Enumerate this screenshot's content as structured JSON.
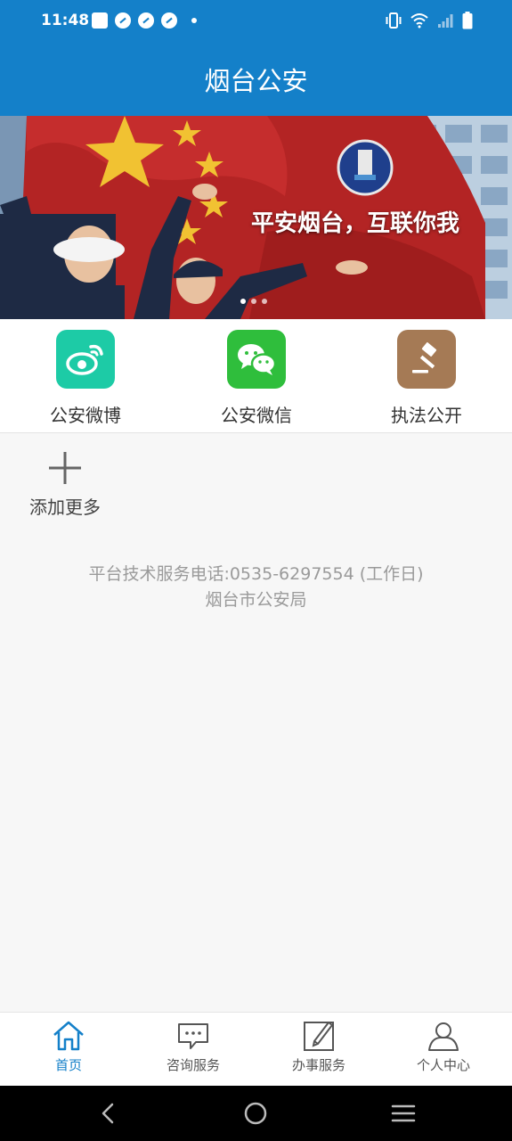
{
  "status_bar": {
    "time": "11:48",
    "left_icons": [
      "mail-icon",
      "app-icon",
      "app-icon",
      "app-icon",
      "dot-icon"
    ],
    "right_icons": [
      "vibrate-icon",
      "wifi-icon",
      "signal-icon",
      "battery-icon"
    ]
  },
  "header": {
    "title": "烟台公安"
  },
  "banner": {
    "slogan": "平安烟台，互联你我",
    "slides": 3,
    "active_slide": 1
  },
  "quick_actions": [
    {
      "label": "公安微博",
      "icon": "weibo-icon",
      "color": "#1dcba6"
    },
    {
      "label": "公安微信",
      "icon": "wechat-icon",
      "color": "#2fbe3c"
    },
    {
      "label": "执法公开",
      "icon": "gavel-icon",
      "color": "#a57a55"
    }
  ],
  "add_more": {
    "label": "添加更多"
  },
  "footer": {
    "line1": "平台技术服务电话:0535-6297554 (工作日)",
    "line2": "烟台市公安局"
  },
  "tabbar": [
    {
      "label": "首页",
      "icon": "home-icon",
      "active": true
    },
    {
      "label": "咨询服务",
      "icon": "chat-icon",
      "active": false
    },
    {
      "label": "办事服务",
      "icon": "edit-icon",
      "active": false
    },
    {
      "label": "个人中心",
      "icon": "person-icon",
      "active": false
    }
  ],
  "colors": {
    "primary": "#1480c9",
    "background": "#f7f7f7"
  }
}
